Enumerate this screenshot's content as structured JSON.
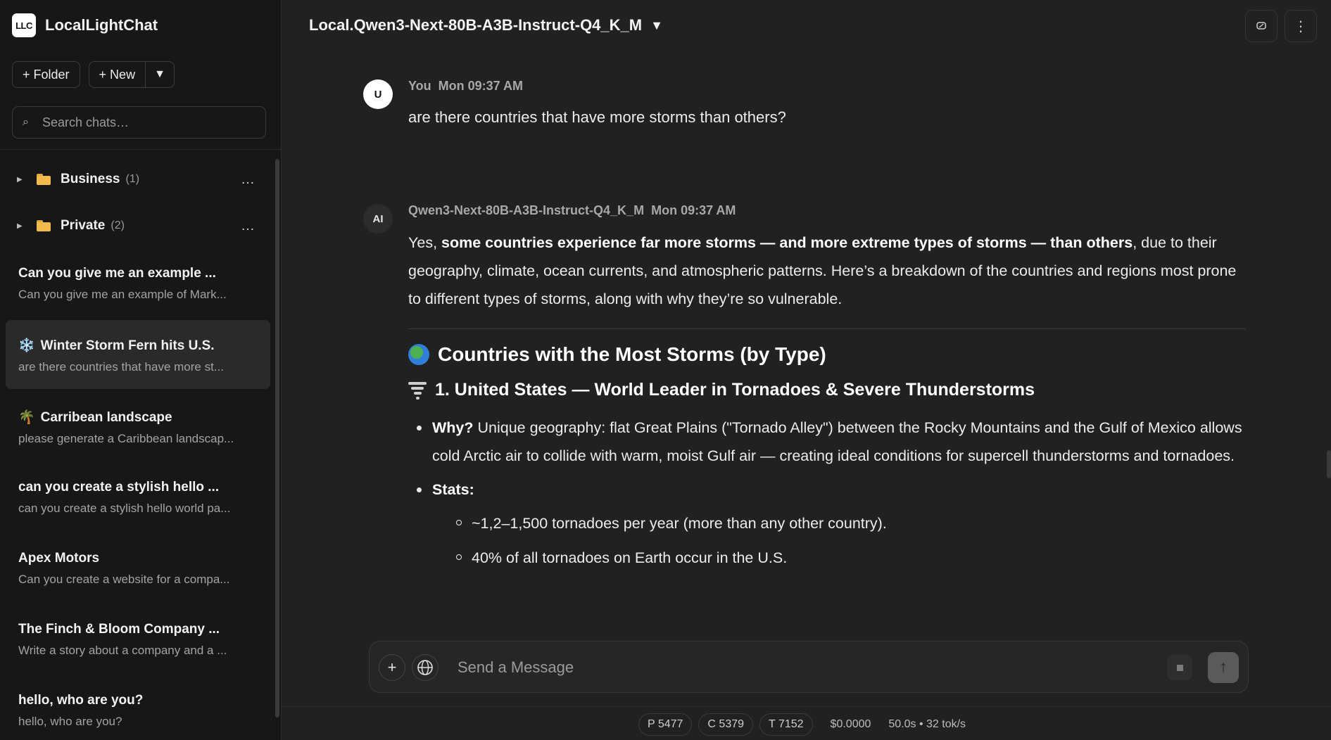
{
  "brand": {
    "logo": "LLC",
    "name": "LocalLightChat"
  },
  "sidebar": {
    "folder_button": "+ Folder",
    "new_button": "+ New",
    "new_menu": "▼",
    "search_placeholder": "Search chats…",
    "folders": [
      {
        "name": "Business",
        "count": "(1)",
        "menu": "…"
      },
      {
        "name": "Private",
        "count": "(2)",
        "menu": "…"
      }
    ],
    "chats": [
      {
        "title": "Can you give me an example ...",
        "preview": "Can you give me an example of Mark...",
        "emoji": ""
      },
      {
        "title": "Winter Storm Fern hits U.S.",
        "preview": "are there countries that have more st...",
        "emoji": "❄️",
        "active": true
      },
      {
        "title": "Carribean landscape",
        "preview": "please generate a Caribbean landscap...",
        "emoji": "🌴"
      },
      {
        "title": "can you create a stylish hello ...",
        "preview": "can you create a stylish hello world pa...",
        "emoji": ""
      },
      {
        "title": "Apex Motors",
        "preview": "Can you create a website for a compa...",
        "emoji": ""
      },
      {
        "title": "The Finch & Bloom Company ...",
        "preview": "Write a story about a company and a ...",
        "emoji": ""
      },
      {
        "title": "hello, who are you?",
        "preview": "hello, who are you?",
        "emoji": ""
      }
    ]
  },
  "header": {
    "model": "Local.Qwen3-Next-80B-A3B-Instruct-Q4_K_M",
    "model_arrow": "▼",
    "menu_icon": "⋮"
  },
  "messages": {
    "user": {
      "avatar": "U",
      "author": "You",
      "time": "Mon 09:37 AM",
      "text": "are there countries that have more storms than others?"
    },
    "ai": {
      "avatar": "AI",
      "author": "Qwen3-Next-80B-A3B-Instruct-Q4_K_M",
      "time": "Mon 09:37 AM",
      "intro_a": "Yes, ",
      "intro_bold": "some countries experience far more storms — and more extreme types of storms — than others",
      "intro_b": ", due to their geography, climate, ocean currents, and atmospheric patterns. Here’s a breakdown of the countries and regions most prone to different types of storms, along with why they’re so vulnerable.",
      "heading": "Countries with the Most Storms (by Type)",
      "subheading": "1. United States — World Leader in Tornadoes & Severe Thunderstorms",
      "why_label": "Why?",
      "why_text": " Unique geography: flat Great Plains (\"Tornado Alley\") between the Rocky Mountains and the Gulf of Mexico allows cold Arctic air to collide with warm, moist Gulf air — creating ideal conditions for supercell thunderstorms and tornadoes.",
      "stats_label": "Stats:",
      "stats": [
        "~1,2–1,500 tornadoes per year (more than any other country).",
        "40% of all tornadoes on Earth occur in the U.S."
      ]
    }
  },
  "composer": {
    "plus": "+",
    "placeholder": "Send a Message",
    "send": "↑"
  },
  "footer": {
    "p": "P 5477",
    "c": "C 5379",
    "t": "T 7152",
    "cost": "$0.0000",
    "speed": "50.0s • 32 tok/s"
  }
}
